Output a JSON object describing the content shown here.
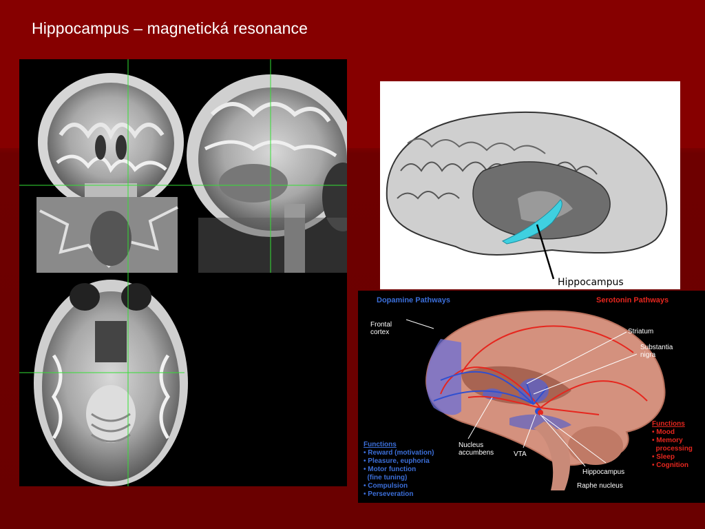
{
  "slide": {
    "title": "Hippocampus – magnetická resonance"
  },
  "brain_illustration": {
    "label": "Hippocampus",
    "highlight_color": "#3fd0e0"
  },
  "pathways": {
    "dopamine_title": "Dopamine Pathways",
    "serotonin_title": "Serotonin Pathways",
    "labels": {
      "frontal_cortex_1": "Frontal",
      "frontal_cortex_2": "cortex",
      "striatum": "Striatum",
      "substantia_1": "Substantia",
      "substantia_2": "nigra",
      "nucleus_1": "Nucleus",
      "nucleus_2": "accumbens",
      "vta": "VTA",
      "hippocampus": "Hippocampus",
      "raphe": "Raphe nucleus"
    },
    "dopamine_functions": {
      "heading": "Functions",
      "items": [
        "• Reward (motivation)",
        "• Pleasure, euphoria",
        "• Motor function",
        "  (fine tuning)",
        "• Compulsion",
        "• Perseveration"
      ]
    },
    "serotonin_functions": {
      "heading": "Functions",
      "items": [
        "• Mood",
        "• Memory",
        "  processing",
        "• Sleep",
        "• Cognition"
      ]
    },
    "colors": {
      "dopamine": "#3b6ed8",
      "serotonin": "#e6261e",
      "brain_tissue": "#d4917e"
    }
  }
}
